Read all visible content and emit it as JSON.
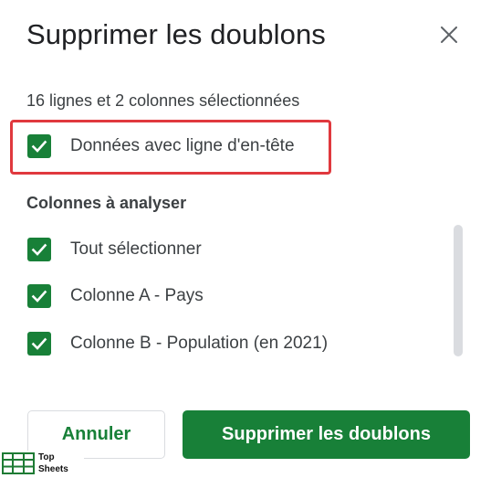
{
  "dialog": {
    "title": "Supprimer les doublons",
    "close_icon": "close-icon",
    "selection_info": "16 lignes et 2 colonnes sélectionnées",
    "header_checkbox": {
      "label": "Données avec ligne d'en-tête",
      "checked": true
    },
    "columns_section_label": "Colonnes à analyser",
    "columns": [
      {
        "label": "Tout sélectionner",
        "checked": true
      },
      {
        "label": "Colonne A - Pays",
        "checked": true
      },
      {
        "label": "Colonne B - Population (en 2021)",
        "checked": true
      }
    ],
    "cancel_label": "Annuler",
    "confirm_label": "Supprimer les doublons"
  },
  "watermark": {
    "line1": "Top",
    "line2": "Sheets",
    "icon": "top-sheets-logo"
  },
  "colors": {
    "accent_green": "#188038",
    "highlight_red": "#e0393e",
    "text": "#3c4043",
    "title": "#202124"
  }
}
